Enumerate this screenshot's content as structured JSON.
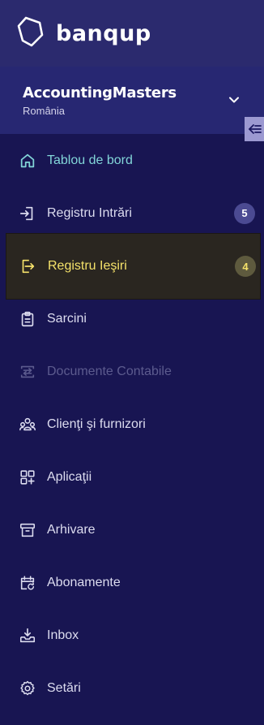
{
  "brand": {
    "name": "banqup"
  },
  "company": {
    "name": "AccountingMasters",
    "country": "România"
  },
  "nav": {
    "items": [
      {
        "label": "Tablou de bord",
        "icon": "home-icon"
      },
      {
        "label": "Registru Intrări",
        "icon": "import-icon",
        "badge": "5"
      },
      {
        "label": "Registru Ieşiri",
        "icon": "export-icon",
        "badge": "4"
      },
      {
        "label": "Sarcini",
        "icon": "clipboard-icon"
      },
      {
        "label": "Documente Contabile",
        "icon": "transfer-docs-icon"
      },
      {
        "label": "Clienţi şi furnizori",
        "icon": "users-icon"
      },
      {
        "label": "Aplicaţii",
        "icon": "apps-icon"
      },
      {
        "label": "Arhivare",
        "icon": "archive-icon"
      },
      {
        "label": "Abonamente",
        "icon": "calendar-refresh-icon"
      },
      {
        "label": "Inbox",
        "icon": "inbox-download-icon"
      },
      {
        "label": "Setări",
        "icon": "gear-icon"
      }
    ]
  },
  "colors": {
    "sidebar_bg": "#181552",
    "header_bg": "#2b2a6e",
    "active_teal": "#82d5d8",
    "selected_yellow": "#f5e26a",
    "badge_bg": "#4b4a92"
  }
}
